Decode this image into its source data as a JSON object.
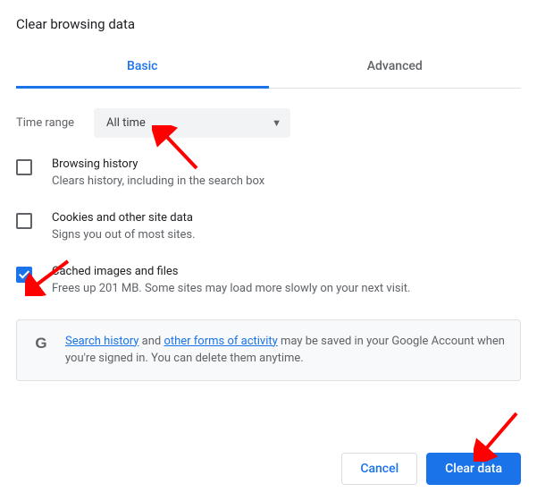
{
  "title": "Clear browsing data",
  "tabs": {
    "basic": "Basic",
    "advanced": "Advanced"
  },
  "time": {
    "label": "Time range",
    "selected": "All time"
  },
  "options": [
    {
      "title": "Browsing history",
      "desc": "Clears history, including in the search box",
      "checked": false
    },
    {
      "title": "Cookies and other site data",
      "desc": "Signs you out of most sites.",
      "checked": false
    },
    {
      "title": "Cached images and files",
      "desc": "Frees up 201 MB. Some sites may load more slowly on your next visit.",
      "checked": true
    }
  ],
  "info": {
    "link1": "Search history",
    "mid1": " and ",
    "link2": "other forms of activity",
    "rest": " may be saved in your Google Account when you're signed in. You can delete them anytime."
  },
  "buttons": {
    "cancel": "Cancel",
    "clear": "Clear data"
  },
  "g_icon": "G"
}
